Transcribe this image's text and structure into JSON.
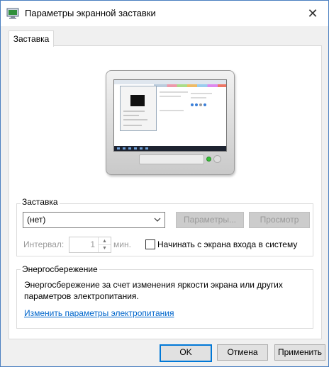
{
  "window": {
    "title": "Параметры экранной заставки",
    "icon": "monitor-settings-icon",
    "close_glyph": "✕"
  },
  "tabs": [
    {
      "label": "Заставка",
      "selected": true
    }
  ],
  "screensaver": {
    "group_label": "Заставка",
    "selected_value": "(нет)",
    "settings_button": "Параметры...",
    "preview_button": "Просмотр",
    "interval_label": "Интервал:",
    "interval_value": "1",
    "interval_unit": "мин.",
    "resume_checkbox_label": "Начинать с экрана входа в систему",
    "resume_checked": false
  },
  "power": {
    "group_label": "Энергосбережение",
    "description": "Энергосбережение за счет изменения яркости экрана или других параметров электропитания.",
    "link": "Изменить параметры электропитания"
  },
  "buttons": {
    "ok": "OK",
    "cancel": "Отмена",
    "apply": "Применить"
  },
  "colors": {
    "accent": "#0078d7",
    "link": "#0066cc",
    "disabled_text": "#9a9a9a"
  }
}
